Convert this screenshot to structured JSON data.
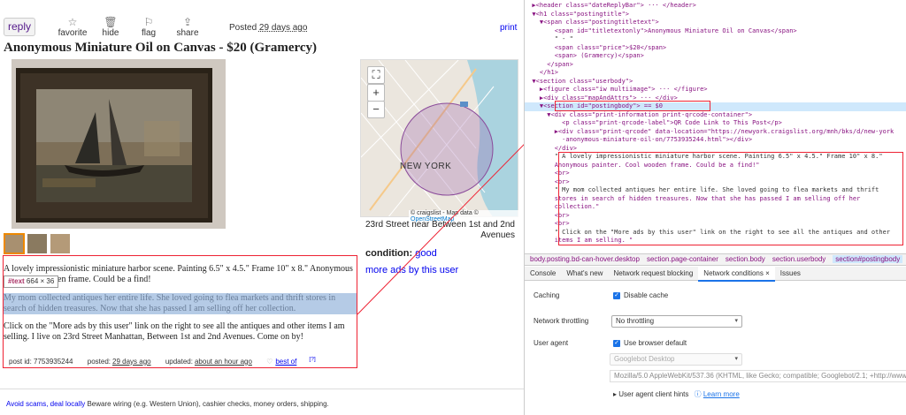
{
  "toolbar": {
    "reply": "reply",
    "favorite": "favorite",
    "hide": "hide",
    "flag": "flag",
    "share": "share",
    "posted_prefix": "Posted",
    "posted_time": "29 days ago",
    "print": "print"
  },
  "posting": {
    "title": "Anonymous Miniature Oil on Canvas - $20 (Gramercy)",
    "location": "23rd Street near Between 1st and 2nd Avenues",
    "condition_label": "condition:",
    "condition_value": "good",
    "more_ads": "more ads by this user",
    "map_label": "NEW YORK",
    "map_attr_prefix": "© craigslist - Map data ©",
    "map_attr_link": "OpenStreetMap",
    "body_p1_a": "A lovely impressionistic miniature harbor scene. Painting 6.5\" x 4.5.\" Frame 10\" x 8.\" Anonymous",
    "body_p1_b": "den frame. Could be a find!",
    "body_p2": "My mom collected antiques her entire life. She loved going to flea markets and thrift stores in search of hidden treasures. Now that she has passed I am selling off her collection.",
    "body_p3": "Click on the \"More ads by this user\" link on the right to see all the antiques and other items I am selling. I live on 23rd Street Manhattan, Between 1st and 2nd Avenues. Come on by!",
    "tooltip_tag": "#text",
    "tooltip_size": "664 × 36",
    "post_id": "post id: 7753935244",
    "posted_label": "posted:",
    "posted_value": "29 days ago",
    "updated_label": "updated:",
    "updated_value": "about an hour ago",
    "best_of": "best of",
    "best_of_sup": "[?]"
  },
  "footer": {
    "scams_link": "Avoid scams, deal locally",
    "scams_text": "Beware wiring (e.g. Western Union), cashier checks, money orders, shipping."
  },
  "devtools": {
    "code_lines": [
      "  ▶<header class=\"dateReplyBar\"> ··· </header>",
      "  ▼<h1 class=\"postingtitle\">",
      "    ▼<span class=\"postingtitletext\">",
      "        <span id=\"titletextonly\">Anonymous Miniature Oil on Canvas</span>",
      "        \" - \"",
      "        <span class=\"price\">$20</span>",
      "        <span> (Gramercy)</span>",
      "      </span>",
      "    </h1>",
      "  ▼<section class=\"userbody\">",
      "    ▶<figure class=\"iw multiimage\"> ··· </figure>",
      "    ▶<div class=\"mapAndAttrs\"> ··· </div>",
      "    ▼<section id=\"postingbody\"> == $0",
      "      ▼<div class=\"print-information print-qrcode-container\">",
      "          <p class=\"print-qrcode-label\">QR Code Link to This Post</p>",
      "        ▶<div class=\"print-qrcode\" data-location=\"https://newyork.craigslist.org/mnh/bks/d/new-york",
      "          -anonymous-miniature-oil-on/7753935244.html\"></div>",
      "        </div>",
      "        \" A lovely impressionistic miniature harbor scene. Painting 6.5\" x 4.5.\" Frame 10\" x 8.\"",
      "        Anonymous painter. Cool wooden frame. Could be a find!\"",
      "        <br>",
      "        <br>",
      "        \" My mom collected antiques her entire life. She loved going to flea markets and thrift",
      "        stores in search of hidden treasures. Now that she has passed I am selling off her",
      "        collection.\"",
      "        <br>",
      "        <br>",
      "        \" Click on the \"More ads by this user\" link on the right to see all the antiques and other",
      "        items I am selling. \""
    ],
    "breadcrumbs": [
      "body.posting.bd-can-hover.desktop",
      "section.page-container",
      "section.body",
      "section.userbody",
      "section#postingbody"
    ],
    "tabs": [
      "Console",
      "What's new",
      "Network request blocking",
      "Network conditions ×",
      "Issues"
    ],
    "caching_label": "Caching",
    "disable_cache": "Disable cache",
    "throttling_label": "Network throttling",
    "throttling_value": "No throttling",
    "ua_label": "User agent",
    "use_default": "Use browser default",
    "ua_select": "Googlebot Desktop",
    "ua_string": "Mozilla/5.0 AppleWebKit/537.36 (KHTML, like Gecko; compatible; Googlebot/2.1; +http://www.google",
    "client_hints": "▸ User agent client hints",
    "learn_more": "Learn more"
  }
}
